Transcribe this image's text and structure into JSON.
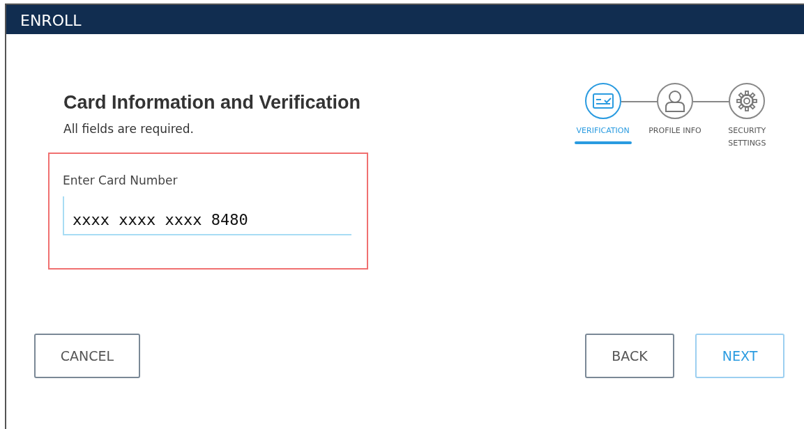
{
  "window": {
    "title": "ENROLL"
  },
  "heading": "Card Information and Verification",
  "subheading": "All fields are required.",
  "steps": [
    {
      "label": "VERIFICATION",
      "kind": "card",
      "selected": true
    },
    {
      "label": "PROFILE INFO",
      "kind": "person",
      "selected": false
    },
    {
      "label": "SECURITY SETTINGS",
      "kind": "gear",
      "selected": false
    }
  ],
  "card_field": {
    "label": "Enter Card Number",
    "value": "xxxx xxxx xxxx 8480",
    "highlighted": true
  },
  "buttons": [
    {
      "label": "CANCEL",
      "kind": "cancel"
    },
    {
      "label": "BACK",
      "kind": "back"
    },
    {
      "label": "NEXT",
      "kind": "next"
    }
  ]
}
